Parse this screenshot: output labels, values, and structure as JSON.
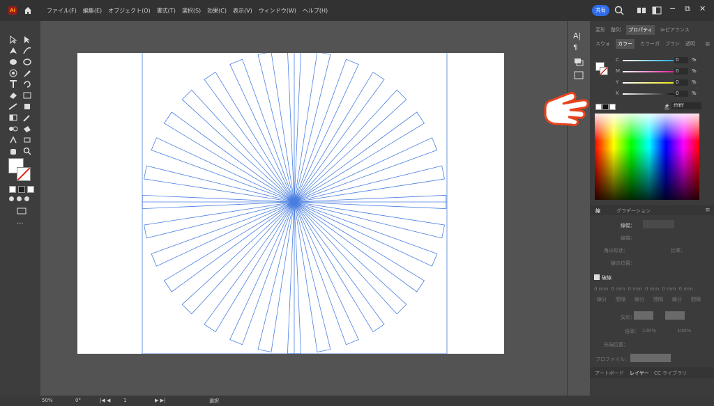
{
  "menubar": {
    "logo": "Ai",
    "items": [
      "ファイル(F)",
      "編集(E)",
      "オブジェクト(O)",
      "書式(T)",
      "選択(S)",
      "効果(C)",
      "表示(V)",
      "ウィンドウ(W)",
      "ヘルプ(H)"
    ],
    "share": "共有"
  },
  "panel": {
    "tabs_top": [
      "変形",
      "整列",
      "プロパティ",
      "≫ピアランス"
    ],
    "tabs_second": [
      "スウォ",
      "カラー",
      "カラーガ",
      "ブラシ",
      "透明"
    ],
    "active_top": "プロパティ",
    "active_second": "カラー",
    "cmyk": [
      {
        "label": "C",
        "value": "0",
        "unit": "%",
        "color": "#25a9e0"
      },
      {
        "label": "M",
        "value": "0",
        "unit": "%",
        "color": "#e0209a"
      },
      {
        "label": "Y",
        "value": "0",
        "unit": "%",
        "color": "#f2e516"
      },
      {
        "label": "K",
        "value": "0",
        "unit": "%",
        "color": "#cccccc"
      }
    ],
    "hex_sign": "#",
    "hex_value": "ffffff",
    "stroke_tabs": [
      "線",
      "グラデーション"
    ],
    "stroke_width_label": "線幅：",
    "cap_label": "線端：",
    "corner_label": "角の形状：",
    "limit_label": "比率：",
    "align_label": "線の位置：",
    "dashed_label": "破線",
    "dash_values": [
      "0 mm",
      "0 mm",
      "0 mm",
      "0 mm",
      "0 mm",
      "0 mm"
    ],
    "dash_labels": [
      "線分",
      "間隔",
      "線分",
      "間隔",
      "線分",
      "間隔"
    ],
    "arrow_label": "矢印：",
    "scale_label": "倍率：",
    "scale_values": [
      "100%",
      "100%"
    ],
    "arrow_align_label": "先端位置：",
    "profile_label": "プロファイル：",
    "bottom_tabs": [
      "アートボード",
      "レイヤー",
      "CC ライブラリ"
    ]
  },
  "statusbar": {
    "zoom": "50%",
    "rotation": "0°",
    "artboard_num": "1",
    "mode": "選択"
  }
}
